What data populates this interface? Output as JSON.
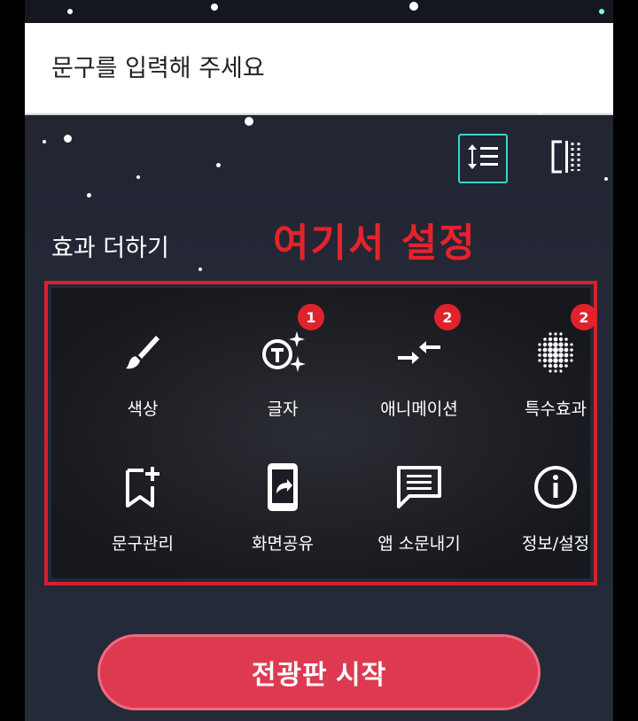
{
  "input": {
    "placeholder": "문구를 입력해 주세요",
    "value": ""
  },
  "toolbar": {
    "line_spacing_icon": "line-spacing-icon",
    "align_icon": "vertical-align-icon",
    "accent_color": "#3dd1cf"
  },
  "section": {
    "title": "효과 더하기"
  },
  "annotation": {
    "text": "여기서 설정",
    "color": "#e6222c"
  },
  "effects": [
    {
      "label": "색상",
      "icon": "brush-icon",
      "badge": ""
    },
    {
      "label": "글자",
      "icon": "text-sparkle-icon",
      "badge": "1"
    },
    {
      "label": "애니메이션",
      "icon": "arrows-inward-icon",
      "badge": "2"
    },
    {
      "label": "특수효과",
      "icon": "dots-sphere-icon",
      "badge": "2"
    },
    {
      "label": "문구관리",
      "icon": "bookmark-add-icon",
      "badge": ""
    },
    {
      "label": "화면공유",
      "icon": "phone-share-icon",
      "badge": ""
    },
    {
      "label": "앱 소문내기",
      "icon": "message-icon",
      "badge": ""
    },
    {
      "label": "정보/설정",
      "icon": "info-icon",
      "badge": ""
    }
  ],
  "start_button": {
    "label": "전광판 시작",
    "color": "#dd3a52"
  }
}
